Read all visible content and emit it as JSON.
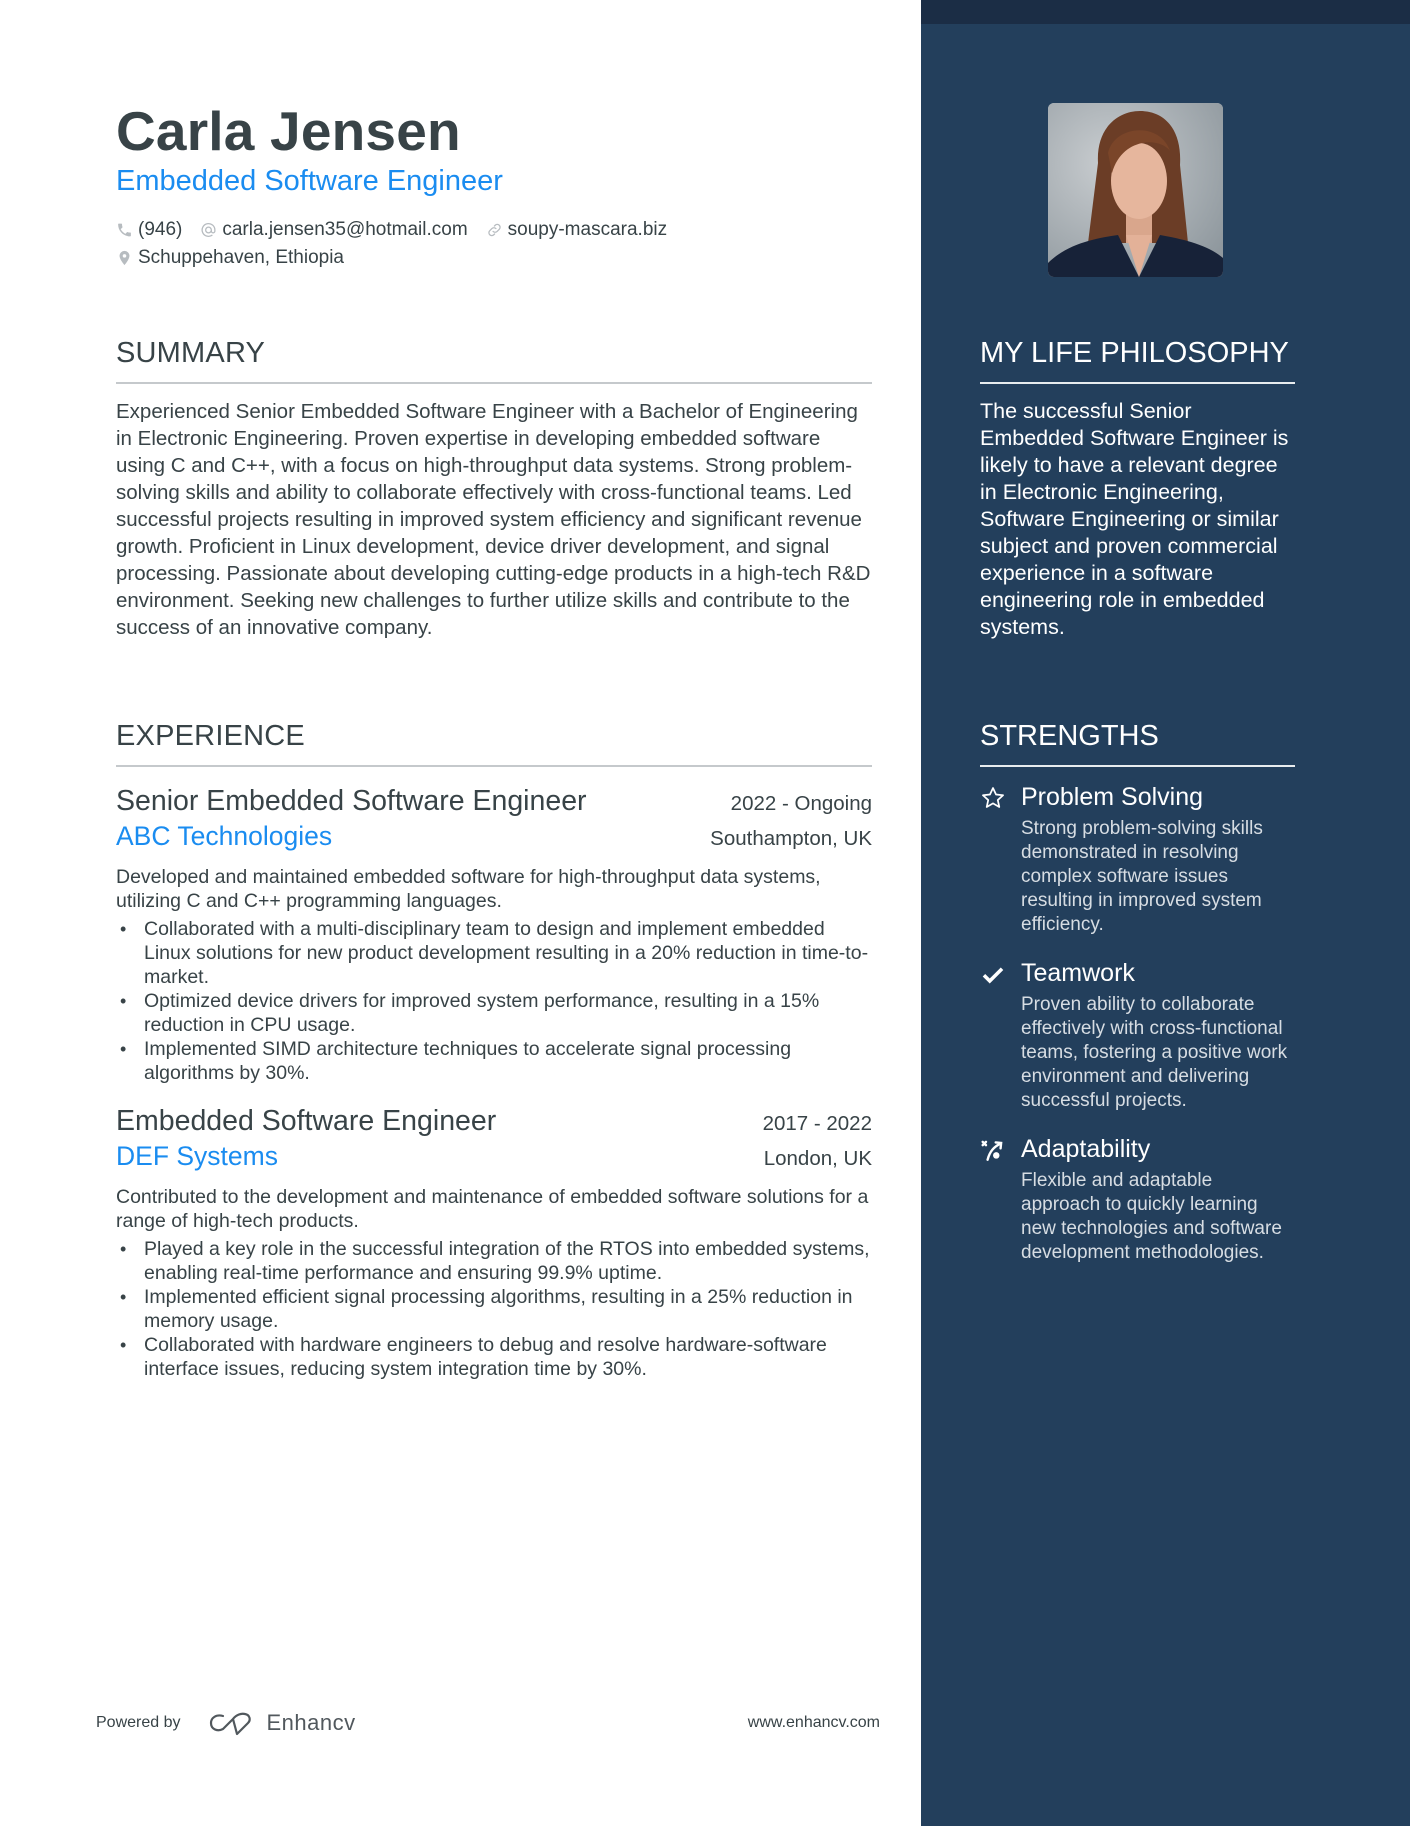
{
  "header": {
    "name": "Carla Jensen",
    "headline": "Embedded Software Engineer",
    "contacts": {
      "phone": "(946)",
      "email": "carla.jensen35@hotmail.com",
      "website": "soupy-mascara.biz",
      "location": "Schuppehaven, Ethiopia"
    },
    "icons": {
      "phone": "phone-icon",
      "email": "at-icon",
      "website": "link-icon",
      "location": "map-pin-icon"
    }
  },
  "summary": {
    "title": "SUMMARY",
    "text": "Experienced Senior Embedded Software Engineer with a Bachelor of Engineering in Electronic Engineering. Proven expertise in developing embedded software using C and C++, with a focus on high-throughput data systems. Strong problem-solving skills and ability to collaborate effectively with cross-functional teams. Led successful projects resulting in improved system efficiency and significant revenue growth. Proficient in Linux development, device driver development, and signal processing. Passionate about developing cutting-edge products in a high-tech R&D environment. Seeking new challenges to further utilize skills and contribute to the success of an innovative company."
  },
  "experience": {
    "title": "EXPERIENCE",
    "jobs": [
      {
        "title": "Senior Embedded Software Engineer",
        "dates": "2022 - Ongoing",
        "company": "ABC Technologies",
        "location": "Southampton, UK",
        "description": "Developed and maintained embedded software for high-throughput data systems, utilizing C and C++ programming languages.",
        "bullets": [
          "Collaborated with a multi-disciplinary team to design and implement embedded Linux solutions for new product development resulting in a 20% reduction in time-to-market.",
          "Optimized device drivers for improved system performance, resulting in a 15% reduction in CPU usage.",
          "Implemented SIMD architecture techniques to accelerate signal processing algorithms by 30%."
        ]
      },
      {
        "title": "Embedded Software Engineer",
        "dates": "2017 - 2022",
        "company": "DEF Systems",
        "location": "London, UK",
        "description": "Contributed to the development and maintenance of embedded software solutions for a range of high-tech products.",
        "bullets": [
          "Played a key role in the successful integration of the RTOS into embedded systems, enabling real-time performance and ensuring 99.9% uptime.",
          "Implemented efficient signal processing algorithms, resulting in a 25% reduction in memory usage.",
          "Collaborated with hardware engineers to debug and resolve hardware-software interface issues, reducing system integration time by 30%."
        ]
      }
    ]
  },
  "sidebar": {
    "photo_alt": "Profile photo of Carla Jensen",
    "philosophy": {
      "title": "MY LIFE PHILOSOPHY",
      "text": "The successful Senior Embedded Software Engineer is likely to have a relevant degree in Electronic Engineering, Software Engineering or similar subject and proven commercial experience in a software engineering role in embedded systems."
    },
    "strengths": {
      "title": "STRENGTHS",
      "items": [
        {
          "icon": "star-icon",
          "title": "Problem Solving",
          "description": "Strong problem-solving skills demonstrated in resolving complex software issues resulting in improved system efficiency."
        },
        {
          "icon": "checkmark-icon",
          "title": "Teamwork",
          "description": "Proven ability to collaborate effectively with cross-functional teams, fostering a positive work environment and delivering successful projects."
        },
        {
          "icon": "strategy-play-icon",
          "title": "Adaptability",
          "description": "Flexible and adaptable approach to quickly learning new technologies and software development methodologies."
        }
      ]
    }
  },
  "footer": {
    "powered_by": "Powered by",
    "brand": "Enhancv",
    "website": "www.enhancv.com"
  },
  "colors": {
    "text": "#384347",
    "accent": "#1a8cf0",
    "sidebar_bg": "#233f5c",
    "sidebar_band": "#1b2d45"
  }
}
